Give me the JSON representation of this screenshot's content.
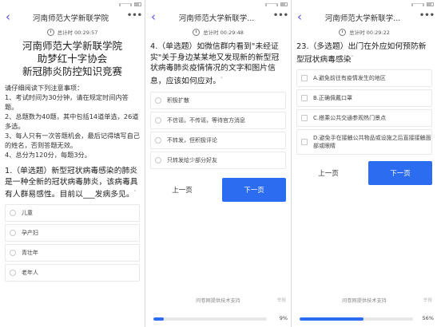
{
  "colors": {
    "accent": "#2b6cf0",
    "back_arrow": "#5a4fd6"
  },
  "panels": [
    {
      "nav_title": "河南师范大学新联学院",
      "timer": "总计时 00:29:57",
      "header_lines": [
        "河南师范大学新联学院",
        "助梦红十字协会",
        "新冠肺炎防控知识竞赛"
      ],
      "notice_lines": [
        "请仔细阅读下列注意事项：",
        "1、考试时间为30分钟，请在规定时间内答题。",
        "2、总题数为40题，其中包括14道单选，26道多选。",
        "3、每人只有一次答题机会，最后记得填写自己的姓名，否则答题无效。",
        "4、总分为120分，每题3分。"
      ],
      "question": "1.（单选题）新型冠状病毒感染的肺炎是一种全新的冠状病毒肺炎，该病毒具有人群易感性。目前以___发病多见。",
      "question_tag": "*",
      "options": [
        "儿童",
        "孕产妇",
        "青壮年",
        "老年人"
      ]
    },
    {
      "nav_title": "河南师范大学新联学...",
      "timer": "总计时 00:29:48",
      "question": "4.（单选题）如微信群内看到\"未经证实\"关于身边某某地又发现新的新型冠状病毒肺炎疫情情况的文字和图片信息，应该如何应对。",
      "question_tag": "*",
      "options": [
        "积极扩散",
        "不信谣，不传谣，等待官方消息",
        "不转发，但积极评论",
        "只转发给少部分好友"
      ],
      "prev_label": "上一页",
      "next_label": "下一页",
      "footer_text": "问卷网提供技术支持",
      "report_label": "举报",
      "progress_percent": 9,
      "progress_text": "9%"
    },
    {
      "nav_title": "河南师范大学新联学...",
      "timer": "总计时 00:29:22",
      "question": "23.（多选题）出门在外应如何预防新型冠状病毒感染",
      "question_tag": "*",
      "options": [
        "A.避免前往有疫情发生的地区",
        "B.正确佩戴口罩",
        "C.搭乘公共交通参观热门景点",
        "D.避免手在接触公共物品或设施之后直接接触面部或眼睛"
      ],
      "prev_label": "上一页",
      "next_label": "下一页",
      "footer_text": "问卷网提供技术支持",
      "report_label": "举报",
      "progress_percent": 56,
      "progress_text": "56%"
    }
  ]
}
